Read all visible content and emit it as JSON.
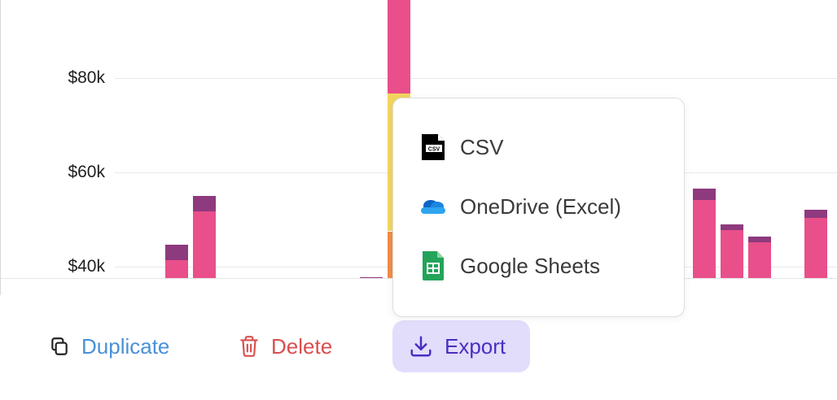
{
  "chart": {
    "y_ticks": [
      "$80k",
      "$60k",
      "$40k"
    ],
    "y_tick_values": [
      80000,
      60000,
      40000
    ],
    "colors": {
      "purple": "#8e3a7e",
      "pink": "#e94f8a",
      "yellow": "#f2d55f",
      "orange": "#f28c46"
    }
  },
  "chart_data": {
    "type": "bar",
    "stacked": true,
    "visible_y_range": [
      35000,
      98000
    ],
    "series_colors": [
      "#f28c46",
      "#f2d55f",
      "#e94f8a",
      "#8e3a7e"
    ],
    "bars": [
      {
        "segments": [
          {
            "color": "purple",
            "from": 34000,
            "to": 35300
          }
        ]
      },
      {
        "segments": [
          {
            "color": "pink",
            "from": 34000,
            "to": 41300
          },
          {
            "color": "purple",
            "from": 41300,
            "to": 44600
          }
        ]
      },
      {
        "segments": [
          {
            "color": "yellow",
            "from": 34000,
            "to": 36800
          },
          {
            "color": "pink",
            "from": 36800,
            "to": 51800
          },
          {
            "color": "purple",
            "from": 51800,
            "to": 55000
          }
        ]
      },
      {
        "segments": [
          {
            "color": "purple",
            "from": 34000,
            "to": 35300
          }
        ]
      },
      {
        "segments": [
          {
            "color": "pink",
            "from": 34000,
            "to": 36300
          },
          {
            "color": "purple",
            "from": 36300,
            "to": 37800
          }
        ]
      },
      {
        "segments": [
          {
            "color": "orange",
            "from": 34000,
            "to": 47500
          },
          {
            "color": "yellow",
            "from": 47500,
            "to": 76700
          },
          {
            "color": "pink",
            "from": 76700,
            "to": 100000
          }
        ]
      },
      {
        "segments": [
          {
            "color": "yellow",
            "from": 34000,
            "to": 36800
          },
          {
            "color": "pink",
            "from": 36800,
            "to": 54100
          },
          {
            "color": "purple",
            "from": 54100,
            "to": 56600
          }
        ]
      },
      {
        "segments": [
          {
            "color": "pink",
            "from": 34000,
            "to": 47700
          },
          {
            "color": "purple",
            "from": 47700,
            "to": 49000
          }
        ]
      },
      {
        "segments": [
          {
            "color": "pink",
            "from": 34000,
            "to": 45100
          },
          {
            "color": "purple",
            "from": 45100,
            "to": 46300
          }
        ]
      },
      {
        "segments": [
          {
            "color": "yellow",
            "from": 34000,
            "to": 35600
          },
          {
            "color": "pink",
            "from": 35600,
            "to": 50300
          },
          {
            "color": "purple",
            "from": 50300,
            "to": 52000
          }
        ]
      }
    ]
  },
  "export_menu": {
    "items": [
      {
        "label": "CSV",
        "icon": "csv-file-icon"
      },
      {
        "label": "OneDrive (Excel)",
        "icon": "onedrive-icon"
      },
      {
        "label": "Google Sheets",
        "icon": "google-sheets-icon"
      }
    ]
  },
  "toolbar": {
    "duplicate_label": "Duplicate",
    "delete_label": "Delete",
    "export_label": "Export",
    "duplicate_icon": "duplicate-icon",
    "delete_icon": "trash-icon",
    "export_icon": "download-icon"
  }
}
